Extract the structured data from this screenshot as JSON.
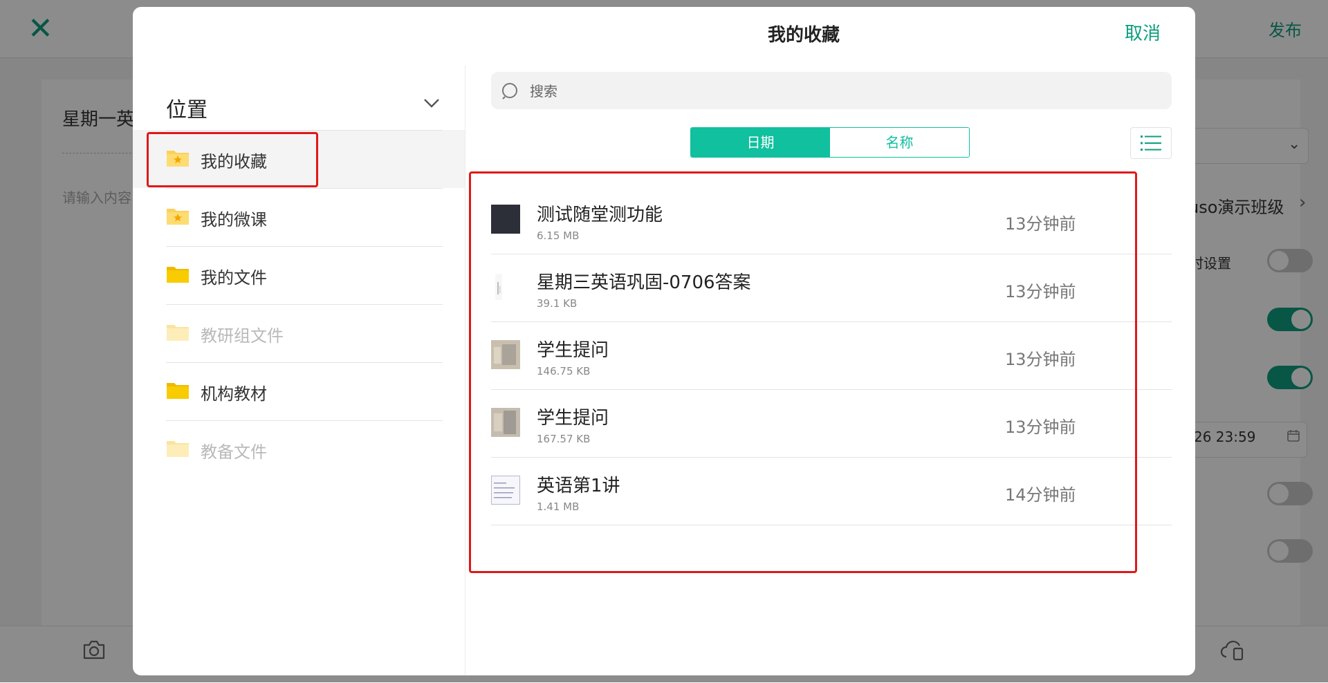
{
  "background": {
    "close_glyph": "✕",
    "publish_label": "发布",
    "title": "星期一英",
    "placeholder": "请输入内容",
    "class_name": "uso演示班级",
    "setting_label": "时设置",
    "date_text": "26 23:59"
  },
  "modal": {
    "title": "我的收藏",
    "cancel_label": "取消",
    "location_label": "位置",
    "folders": [
      {
        "label": "我的收藏",
        "icon": "star-folder-icon"
      },
      {
        "label": "我的微课",
        "icon": "star-folder-icon"
      },
      {
        "label": "我的文件",
        "icon": "folder-icon"
      },
      {
        "label": "教研组文件",
        "icon": "folder-icon"
      },
      {
        "label": "机构教材",
        "icon": "folder-icon"
      },
      {
        "label": "教备文件",
        "icon": "folder-icon"
      }
    ],
    "search": {
      "placeholder": "搜索"
    },
    "sort": {
      "date_label": "日期",
      "name_label": "名称"
    },
    "files": [
      {
        "name": "测试随堂测功能",
        "size": "6.15 MB",
        "time": "13分钟前"
      },
      {
        "name": "星期三英语巩固-0706答案",
        "size": "39.1 KB",
        "time": "13分钟前"
      },
      {
        "name": "学生提问",
        "size": "146.75 KB",
        "time": "13分钟前"
      },
      {
        "name": "学生提问",
        "size": "167.57 KB",
        "time": "13分钟前"
      },
      {
        "name": "英语第1讲",
        "size": "1.41 MB",
        "time": "14分钟前"
      }
    ]
  },
  "colors": {
    "accent": "#0f9d7e",
    "segment_active": "#10c09f",
    "folder_yellow": "#f5c400",
    "highlight": "#e01818"
  }
}
